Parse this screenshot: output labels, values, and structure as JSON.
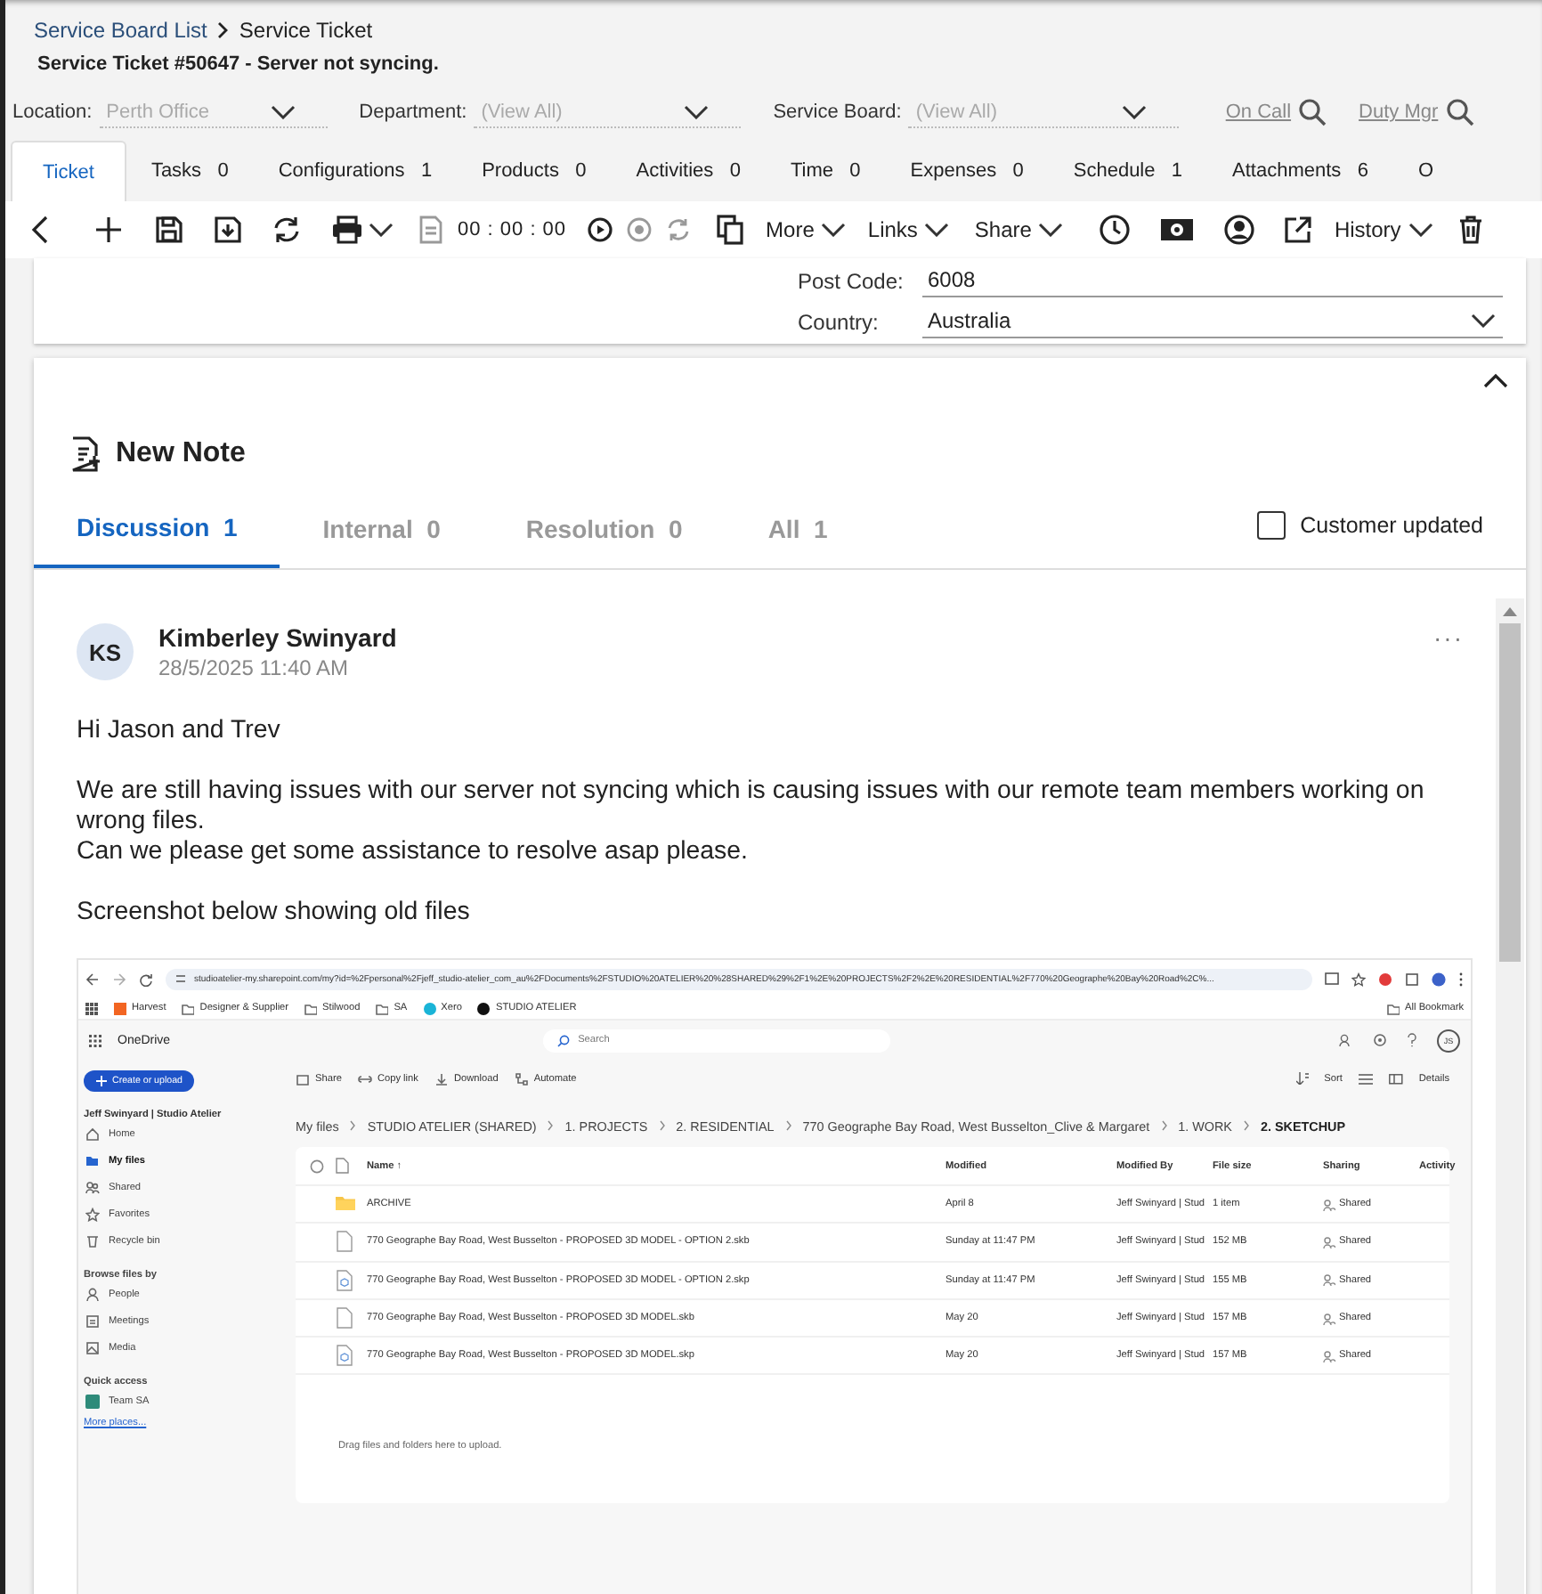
{
  "breadcrumb": [
    "Service Board List",
    "Service Ticket"
  ],
  "title": "Service Ticket #50647 - Server not syncing.",
  "filters": [
    {
      "label": "Location:",
      "value": "Perth Office"
    },
    {
      "label": "Department:",
      "placeholder": "(View All)"
    },
    {
      "label": "Service Board:",
      "placeholder": "(View All)"
    }
  ],
  "header_links": [
    "On Call",
    "Duty Mgr"
  ],
  "tabs": [
    {
      "label": "Ticket",
      "selected": true
    },
    {
      "label": "Tasks",
      "count": "0",
      "selected": false
    },
    {
      "label": "Configurations",
      "count": "1",
      "selected": false
    },
    {
      "label": "Products",
      "count": "0",
      "selected": false
    },
    {
      "label": "Activities",
      "count": "0",
      "selected": false
    },
    {
      "label": "Time",
      "count": "0",
      "selected": false
    },
    {
      "label": "Expenses",
      "count": "0",
      "selected": false
    },
    {
      "label": "Schedule",
      "count": "1",
      "selected": false
    },
    {
      "label": "Attachments",
      "count": "6",
      "selected": false
    },
    {
      "label": "O",
      "selected": false
    }
  ],
  "toolbar": {
    "timer": "00 : 00 : 00",
    "menus": [
      "More",
      "Links",
      "Share",
      "History"
    ]
  },
  "address": [
    {
      "label": "Post Code:",
      "value": "6008",
      "kind": "text"
    },
    {
      "label": "Country:",
      "value": "Australia",
      "kind": "dropdown"
    }
  ],
  "notes": {
    "heading": "New Note",
    "tabs": [
      {
        "label": "Discussion",
        "count": "1",
        "selected": true
      },
      {
        "label": "Internal",
        "count": "0",
        "selected": false
      },
      {
        "label": "Resolution",
        "count": "0",
        "selected": false
      },
      {
        "label": "All",
        "count": "1",
        "selected": false
      }
    ],
    "customer_updated": {
      "label": "Customer updated",
      "checked": false
    },
    "post": {
      "initials": "KS",
      "author": "Kimberley Swinyard",
      "date": "28/5/2025 11:40 AM",
      "more": "···",
      "paragraphs": [
        [
          "Hi Jason and Trev"
        ],
        [
          "We are still having issues with our server not syncing which is causing issues with our remote team members working on wrong files.",
          "Can we please get some assistance to resolve asap please."
        ],
        [
          "Screenshot below showing old files"
        ]
      ]
    }
  },
  "screenshot": {
    "url": "studioatelier-my.sharepoint.com/my?id=%2Fpersonal%2Fjeff_studio-atelier_com_au%2FDocuments%2FSTUDIO%20ATELIER%20%28SHARED%29%2F1%2E%20PROJECTS%2F2%2E%20RESIDENTIAL%2F770%20Geographe%20Bay%20Road%2C%...",
    "bookmarks": [
      "Harvest",
      "Designer & Supplier",
      "Stilwood",
      "SA",
      "Xero",
      "STUDIO ATELIER"
    ],
    "all_bookmarks": "All Bookmark",
    "app_name": "OneDrive",
    "search_placeholder": "Search",
    "avatar": "JS",
    "create_button": "Create or upload",
    "owner": "Jeff Swinyard | Studio Atelier",
    "nav": [
      {
        "label": "Home",
        "selected": false
      },
      {
        "label": "My files",
        "selected": true
      },
      {
        "label": "Shared",
        "selected": false
      },
      {
        "label": "Favorites",
        "selected": false
      },
      {
        "label": "Recycle bin",
        "selected": false
      }
    ],
    "nav_sections": [
      {
        "heading": "Browse files by",
        "items": [
          "People",
          "Meetings",
          "Media"
        ]
      },
      {
        "heading": "Quick access",
        "items": [
          "Team SA"
        ]
      }
    ],
    "more_places": "More places...",
    "commands": [
      "Share",
      "Copy link",
      "Download",
      "Automate"
    ],
    "view_commands": [
      "Sort",
      "Details"
    ],
    "path": [
      "My files",
      "STUDIO ATELIER (SHARED)",
      "1. PROJECTS",
      "2. RESIDENTIAL",
      "770 Geographe Bay Road, West Busselton_Clive & Margaret",
      "1. WORK",
      "2. SKETCHUP"
    ],
    "columns": [
      "Name ↑",
      "Modified",
      "Modified By",
      "File size",
      "Sharing",
      "Activity"
    ],
    "files": [
      {
        "kind": "folder",
        "name": "ARCHIVE",
        "modified": "April 8",
        "modified_by": "Jeff Swinyard | Stud",
        "size": "1 item",
        "sharing": "Shared"
      },
      {
        "kind": "file",
        "name": "770 Geographe Bay Road, West Busselton - PROPOSED 3D MODEL - OPTION 2.skb",
        "modified": "Sunday at 11:47 PM",
        "modified_by": "Jeff Swinyard | Stud",
        "size": "152 MB",
        "sharing": "Shared"
      },
      {
        "kind": "model",
        "name": "770 Geographe Bay Road, West Busselton - PROPOSED 3D MODEL - OPTION 2.skp",
        "modified": "Sunday at 11:47 PM",
        "modified_by": "Jeff Swinyard | Stud",
        "size": "155 MB",
        "sharing": "Shared"
      },
      {
        "kind": "file",
        "name": "770 Geographe Bay Road, West Busselton - PROPOSED 3D MODEL.skb",
        "modified": "May 20",
        "modified_by": "Jeff Swinyard | Stud",
        "size": "157 MB",
        "sharing": "Shared"
      },
      {
        "kind": "model",
        "name": "770 Geographe Bay Road, West Busselton - PROPOSED 3D MODEL.skp",
        "modified": "May 20",
        "modified_by": "Jeff Swinyard | Stud",
        "size": "157 MB",
        "sharing": "Shared"
      }
    ],
    "drop_hint": "Drag files and folders here to upload."
  }
}
